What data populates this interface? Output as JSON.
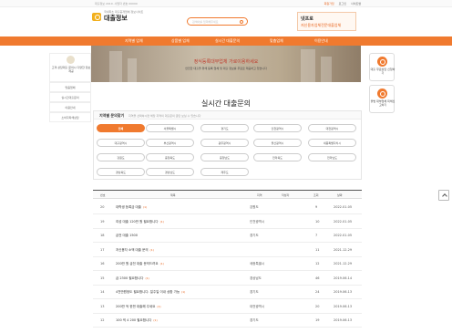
{
  "topbar": {
    "left": "대출정보 2019. 사업자 번호 00000",
    "right": [
      "회원가입",
      "로그인",
      "사이트맵"
    ]
  },
  "logo": {
    "sub": "국내최초 대출중개업체 정보사이트",
    "main": "대출정보"
  },
  "search": {
    "placeholder": "검색어를 입력해주세요"
  },
  "banner": {
    "line1": "넷프로",
    "line2": "저신용자업체전문대출업체"
  },
  "nav": [
    "지역별 업체",
    "상품별 업체",
    "실시간 대출문의",
    "맞춤업체",
    "이용안내"
  ],
  "hero": {
    "headline": "정식등록대부업체 가로이용하세요",
    "sub": "안전한 대출을 위해 등록 업체 및 대출 정보를 무료로 제공하고 있습니다"
  },
  "sidebar": {
    "desc": "고객 상담대출 문의시 다양한 정보 제공",
    "menu": [
      "맞춤업체",
      "실시간대출문의",
      "이용안내",
      "소비자피해상담"
    ]
  },
  "right_buttons": [
    {
      "label": "대출 무료상담 신청하기"
    },
    {
      "label": "불법 대부업체 피해신고하기"
    }
  ],
  "page_title": "실시간 대출문의",
  "filter": {
    "title": "지역별 문의찾기",
    "hint": "지역을 선택하시면 해당 지역의 대출문의 글만 보실 수 있습니다",
    "regions": [
      "전체",
      "서울특별시",
      "경기도",
      "인천광역시",
      "대전광역시",
      "대구광역시",
      "부산광역시",
      "광주광역시",
      "울산광역시",
      "세종특별자치시",
      "강원도",
      "충청북도",
      "충청남도",
      "전라북도",
      "전라남도",
      "경상북도",
      "경상남도",
      "제주도"
    ],
    "selected": "전체"
  },
  "table": {
    "headers": [
      "번호",
      "제목",
      "지역",
      "작성자",
      "조회",
      "날짜"
    ],
    "rows": [
      {
        "no": "20",
        "subject": "대학생 등록금 대출",
        "tag": "(1)",
        "region": "강원도",
        "author": "",
        "views": "9",
        "date": "2022.01.05"
      },
      {
        "no": "19",
        "subject": "여성 대출 120만 원 필요합니다",
        "tag": "(1)",
        "region": "인천광역시",
        "author": "",
        "views": "10",
        "date": "2022.01.05"
      },
      {
        "no": "18",
        "subject": "급전 대출 1500",
        "tag": "",
        "region": "경기도",
        "author": "",
        "views": "7",
        "date": "2022.01.05"
      },
      {
        "no": "17",
        "subject": "저신용자 소액 대출 문의",
        "tag": "(1)",
        "region": "",
        "author": "",
        "views": "11",
        "date": "2021.12.29"
      },
      {
        "no": "16",
        "subject": "200만 원 급전 대출 문의드려요",
        "tag": "(1)",
        "region": "세종특별시",
        "author": "",
        "views": "12",
        "date": "2021.12.29"
      },
      {
        "no": "15",
        "subject": "급 2300 필요합니다",
        "tag": "(1)",
        "region": "경상남도",
        "author": "",
        "views": "46",
        "date": "2019.06.14"
      },
      {
        "no": "14",
        "subject": "4천만원정도 필요합니다. 일주일 이내 상환 가능",
        "tag": "(1)",
        "region": "경기도",
        "author": "",
        "views": "24",
        "date": "2019.06.13"
      },
      {
        "no": "13",
        "subject": "200만 씩 한번 대출해 주세요",
        "tag": "(1)",
        "region": "대전광역시",
        "author": "",
        "views": "20",
        "date": "2019.06.13"
      },
      {
        "no": "12",
        "subject": "100 씩 4 200 필요합니다",
        "tag": "(1)",
        "region": "경기도",
        "author": "",
        "views": "19",
        "date": "2019.06.13"
      }
    ]
  },
  "colors": {
    "accent": "#f07a2f",
    "hero_text": "#c0392b"
  }
}
